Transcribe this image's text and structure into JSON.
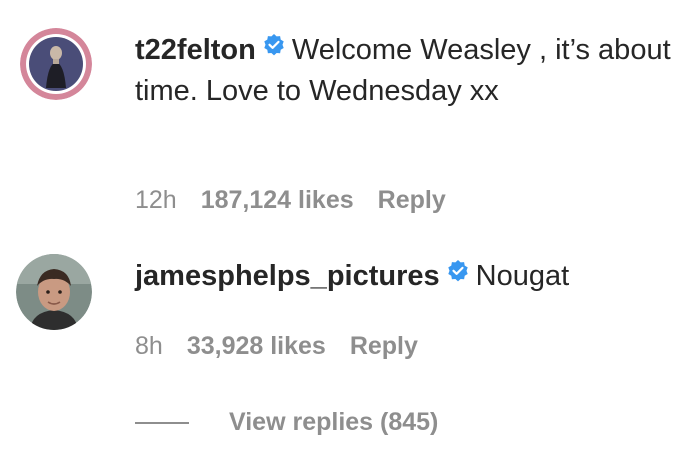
{
  "comments": [
    {
      "username": "t22felton",
      "verified": true,
      "text": "Welcome Weasley , it’s about time. Love to Wednesday xx",
      "time": "12h",
      "likes": "187,124 likes",
      "reply_label": "Reply"
    },
    {
      "username": "jamesphelps_pictures",
      "verified": true,
      "text": "Nougat",
      "time": "8h",
      "likes": "33,928 likes",
      "reply_label": "Reply"
    }
  ],
  "view_replies_label": "View replies (845)",
  "colors": {
    "text": "#262626",
    "secondary": "#8e8e8e",
    "verified": "#3897f0",
    "story_ring": "#d4869a"
  }
}
